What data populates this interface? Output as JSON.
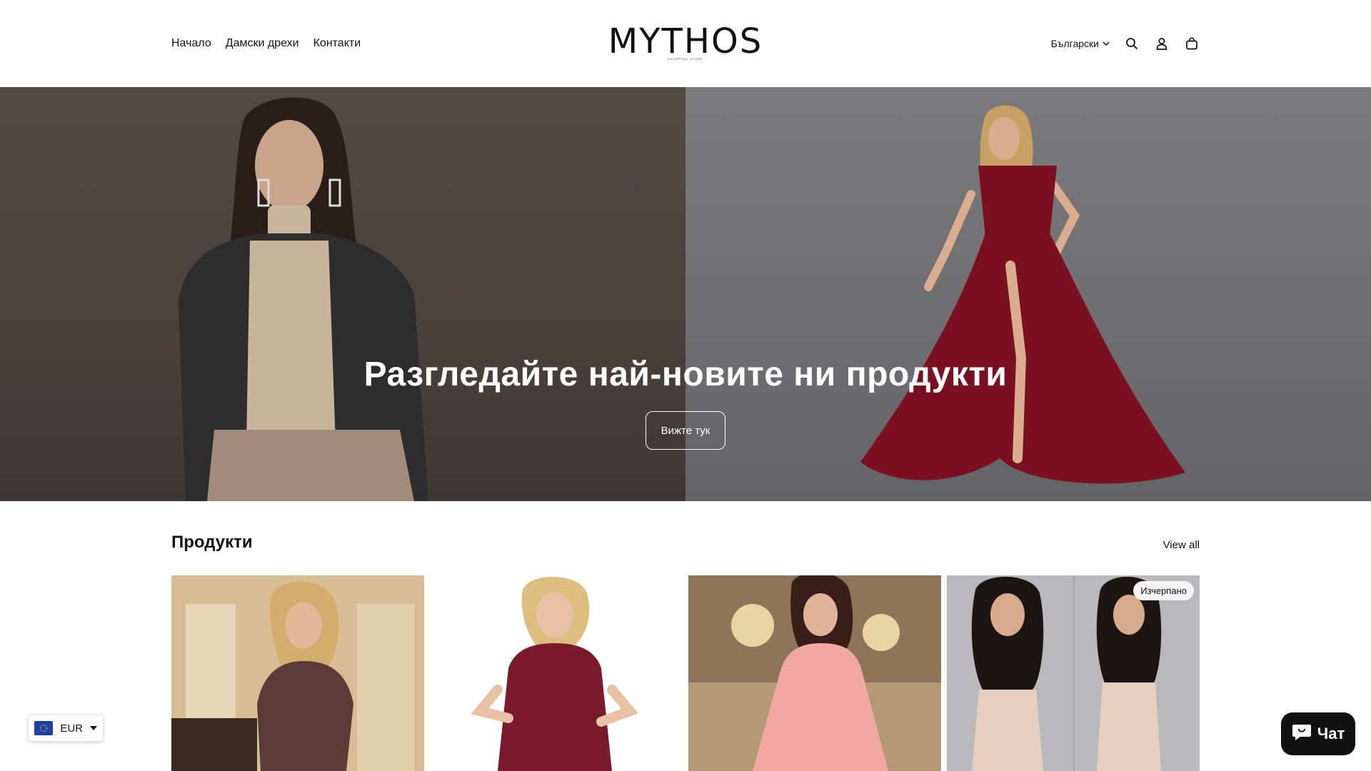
{
  "header": {
    "nav": [
      "Начало",
      "Дамски дрехи",
      "Контакти"
    ],
    "logo": "MYTHOS",
    "logo_sub": "SHOPPING STORE",
    "language": "Български",
    "icons": [
      "search-icon",
      "account-icon",
      "cart-icon"
    ]
  },
  "hero": {
    "title": "Разгледайте най-новите ни продукти",
    "button": "Вижте тук"
  },
  "products": {
    "title": "Продукти",
    "view_all": "View all",
    "items": [
      {
        "image": "woman-in-patterned-wrap-dress",
        "badge": ""
      },
      {
        "image": "woman-in-burgundy-lace-dress",
        "badge": ""
      },
      {
        "image": "woman-in-pink-lace-gown",
        "badge": ""
      },
      {
        "image": "woman-in-beige-strapless-outfits",
        "badge": "Изчерпано"
      }
    ]
  },
  "currency": {
    "code": "EUR",
    "flag": "eu-flag-icon"
  },
  "chat": {
    "label": "Чат"
  },
  "colors": {
    "text": "#121212",
    "hero_overlay_left": "#4a423b",
    "hero_overlay_right": "#6e6e71",
    "chat_bg": "#111111",
    "dress_burgundy": "#7a1020"
  }
}
